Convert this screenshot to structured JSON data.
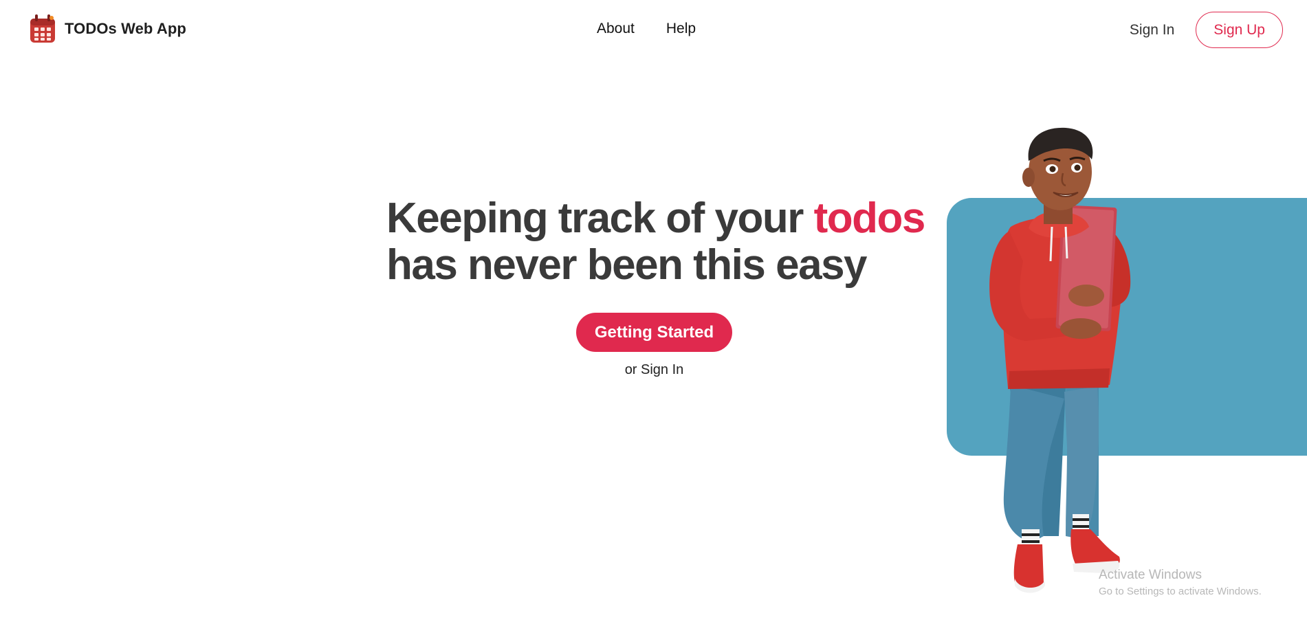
{
  "header": {
    "brand_name": "TODOs Web App",
    "logo_icon": "calendar-grid-icon",
    "nav": [
      "About",
      "Help"
    ],
    "sign_in": "Sign In",
    "sign_up": "Sign Up"
  },
  "hero": {
    "headline_part1": "Keeping track of your ",
    "headline_accent": "todos",
    "headline_line2": "has never been this easy",
    "cta_label": "Getting Started",
    "alt_link": "or Sign In"
  },
  "watermark": {
    "title": "Activate Windows",
    "subtitle": "Go to Settings to activate Windows."
  },
  "colors": {
    "accent": "#e0294e",
    "headline_text": "#3a3a3a",
    "illustration_panel": "#54a3bf"
  }
}
